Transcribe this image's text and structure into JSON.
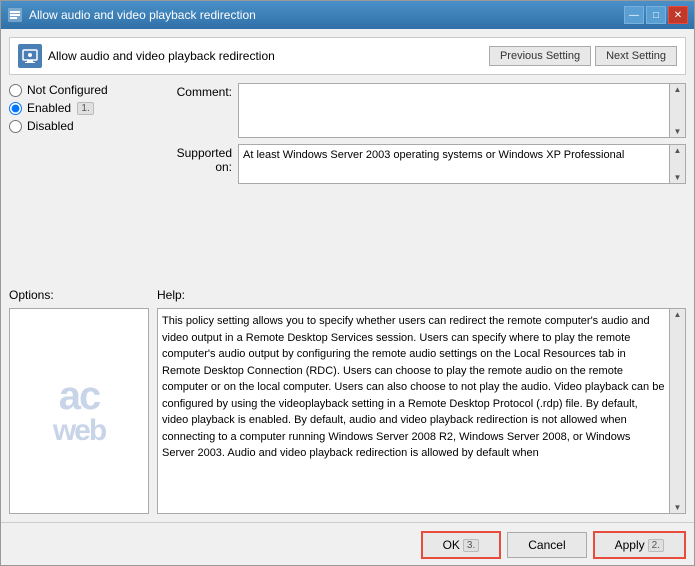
{
  "window": {
    "title": "Allow audio and video playback redirection",
    "icon": "settings-icon"
  },
  "title_buttons": {
    "minimize": "—",
    "maximize": "□",
    "close": "✕"
  },
  "header": {
    "policy_name": "Allow audio and video playback redirection",
    "prev_button": "Previous Setting",
    "next_button": "Next Setting"
  },
  "radio_options": {
    "not_configured": "Not Configured",
    "enabled": "Enabled",
    "enabled_badge": "1.",
    "disabled": "Disabled",
    "selected": "enabled"
  },
  "comment_label": "Comment:",
  "supported_label": "Supported on:",
  "supported_text": "At least Windows Server 2003 operating systems or Windows XP Professional",
  "options_label": "Options:",
  "help_label": "Help:",
  "help_text": "This policy setting allows you to specify whether users can redirect the remote computer's audio and video output in a Remote Desktop Services session.\nUsers can specify where to play the remote computer's audio output by configuring the remote audio settings on the Local Resources tab in Remote Desktop Connection (RDC). Users can choose to play the remote audio on the remote computer or on the local computer. Users can also choose to not play the audio. Video playback can be configured by using the videoplayback setting in a Remote Desktop Protocol (.rdp) file. By default, video playback is enabled.\n\nBy default, audio and video playback redirection is not allowed when connecting to a computer running Windows Server 2008 R2, Windows Server 2008, or Windows Server 2003. Audio and video playback redirection is allowed by default when",
  "footer": {
    "ok_label": "OK",
    "cancel_label": "Cancel",
    "apply_label": "Apply",
    "apply_badge": "2.",
    "ok_badge": "3."
  }
}
